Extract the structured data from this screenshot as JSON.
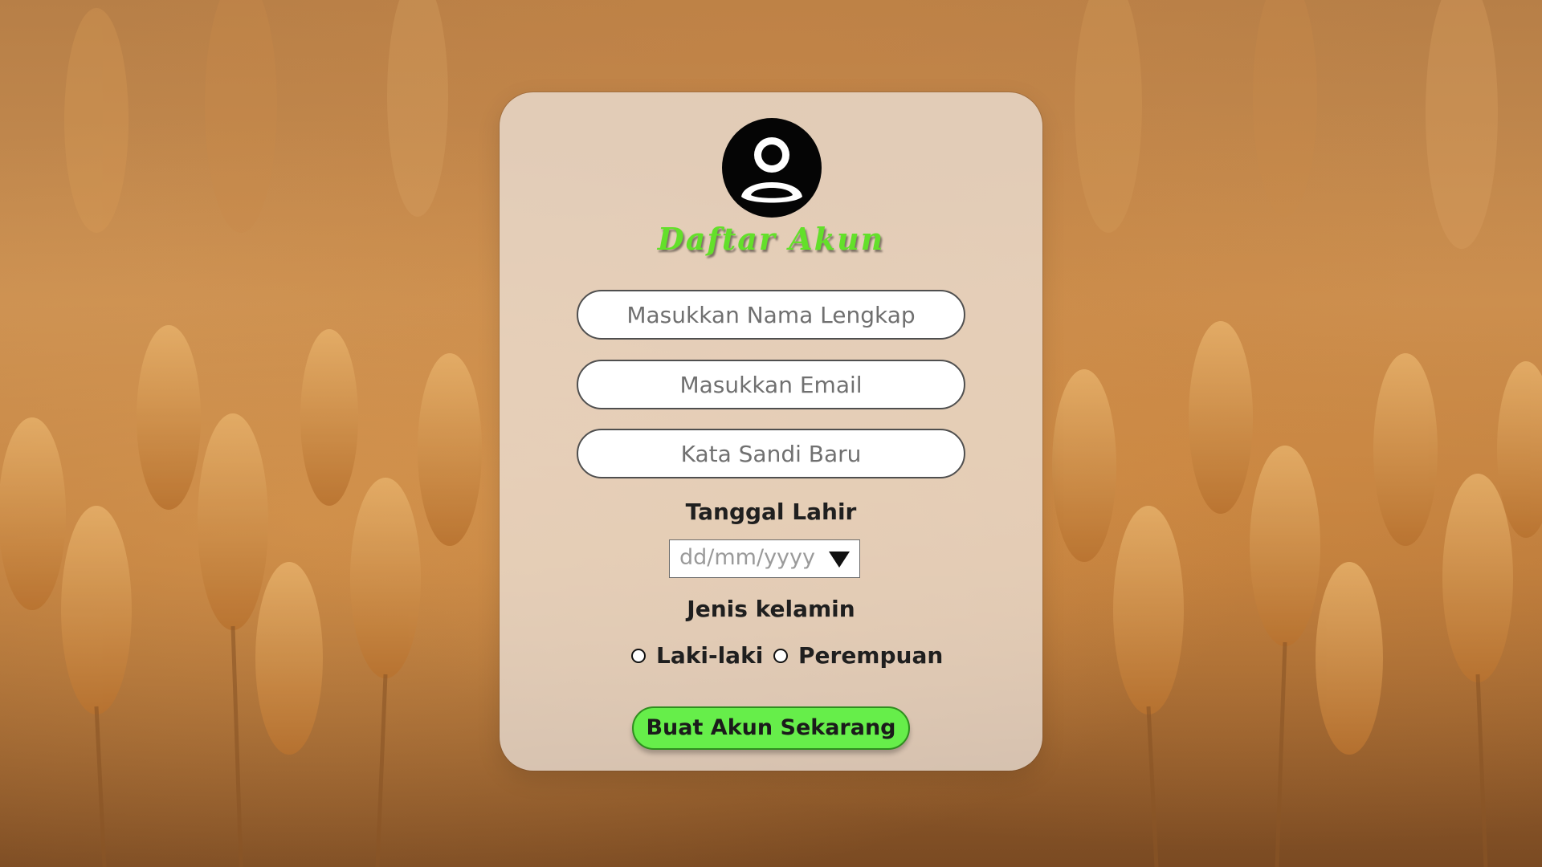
{
  "form": {
    "title": "Daftar Akun",
    "name_placeholder": "Masukkan Nama Lengkap",
    "email_placeholder": "Masukkan Email",
    "password_placeholder": "Kata Sandi Baru",
    "birthdate_label": "Tanggal Lahir",
    "birthdate_placeholder": "dd/mm/yyyy",
    "gender_label": "Jenis kelamin",
    "gender_options": [
      "Laki-laki",
      "Perempuan"
    ],
    "submit_label": "Buat Akun Sekarang"
  },
  "colors": {
    "title": "#63e02a",
    "submit_bg": "#66ee4a",
    "card_bg": "rgba(238,232,226,0.72)"
  },
  "icons": {
    "avatar": "user-circle-icon",
    "date_dropdown": "triangle-down-icon"
  }
}
